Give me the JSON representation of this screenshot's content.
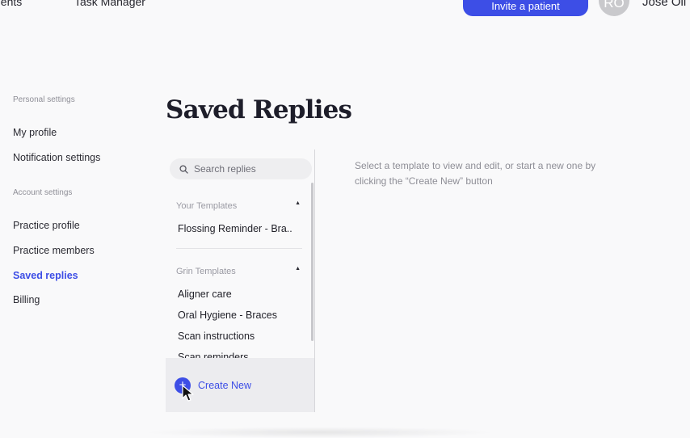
{
  "nav": {
    "patients": "atients",
    "task_manager": "Task Manager",
    "invite_button": "Invite a patient",
    "avatar_initials": "RO",
    "user_name": "Jose Oli"
  },
  "sidebar": {
    "personal_section": "Personal settings",
    "my_profile": "My profile",
    "notification_settings": "Notification settings",
    "account_section": "Account settings",
    "practice_profile": "Practice profile",
    "practice_members": "Practice members",
    "saved_replies": "Saved replies",
    "billing": "Billing",
    "active_item": "Saved replies"
  },
  "page": {
    "title": "Saved Replies",
    "hint": "Select a template to view and edit, or start a new one by clicking the “Create New” button"
  },
  "templates": {
    "search_placeholder": "Search replies",
    "your_templates": {
      "label": "Your Templates",
      "items": [
        "Flossing Reminder - Bra.."
      ]
    },
    "grin_templates": {
      "label": "Grin Templates",
      "items": [
        "Aligner care",
        "Oral Hygiene - Braces",
        "Scan instructions",
        "Scan reminders"
      ]
    },
    "create_new": "Create New",
    "create_icon": "+"
  },
  "colors": {
    "accent": "#3d4ee6",
    "background": "#f9f9fa",
    "muted_text": "#8e8e96"
  },
  "icons": [
    "search-icon",
    "caret-up-icon",
    "plus-icon",
    "pointer-cursor-icon"
  ]
}
